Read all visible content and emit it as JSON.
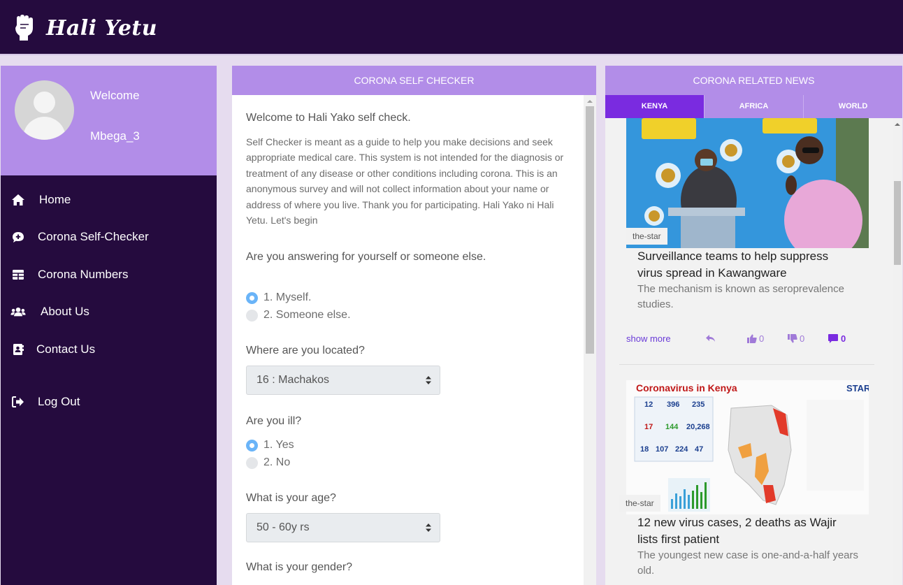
{
  "app": {
    "name": "Hali Yetu"
  },
  "sidebar": {
    "welcome": "Welcome",
    "username": "Mbega_3",
    "items": [
      {
        "label": "Home",
        "icon": "home-icon"
      },
      {
        "label": "Corona Self-Checker",
        "icon": "comment-medical-icon"
      },
      {
        "label": "Corona Numbers",
        "icon": "table-icon"
      },
      {
        "label": "About Us",
        "icon": "users-icon"
      },
      {
        "label": "Contact Us",
        "icon": "address-book-icon"
      },
      {
        "label": "Log Out",
        "icon": "sign-out-icon"
      }
    ]
  },
  "checker": {
    "header": "CORONA SELF CHECKER",
    "intro_title": "Welcome to Hali Yako self check.",
    "intro_text": "Self Checker is meant as a guide to help you make decisions and seek appropriate medical care. This system is not intended for the diagnosis or treatment of any disease or other conditions including corona. This is an anonymous survey and will not collect information about your name or address of where you live. Thank you for participating. Hali Yako ni Hali Yetu. Let's begin",
    "q_who": "Are you answering for yourself or someone else.",
    "who_options": [
      "1. Myself.",
      "2. Someone else."
    ],
    "q_location": "Where are you located?",
    "location_value": "16 : Machakos",
    "q_ill": "Are you ill?",
    "ill_options": [
      "1. Yes",
      "2. No"
    ],
    "q_age": "What is your age?",
    "age_value": "50 - 60y rs",
    "q_gender": "What is your gender?"
  },
  "news": {
    "header": "CORONA RELATED NEWS",
    "tabs": [
      "KENYA",
      "AFRICA",
      "WORLD"
    ],
    "articles": [
      {
        "source": "the-star",
        "title": "Surveillance teams to help suppress virus spread in Kawangware",
        "desc": "The mechanism is known as seroprevalence studies.",
        "show_more": "show more",
        "likes": "0",
        "dislikes": "0",
        "comments": "0"
      },
      {
        "source": "the-star",
        "title": "12 new virus cases, 2 deaths as Wajir lists first patient",
        "desc": "The youngest new case is one-and-a-half years old.",
        "infographic": {
          "heading": "Coronavirus in Kenya",
          "logo": "STAR",
          "stats": [
            "12",
            "396",
            "235",
            "17",
            "144",
            "20,268",
            "18",
            "107",
            "224",
            "47"
          ]
        }
      }
    ]
  },
  "colors": {
    "topbar": "#250b3e",
    "accent": "#b28de8",
    "active_tab": "#7a2be0"
  }
}
